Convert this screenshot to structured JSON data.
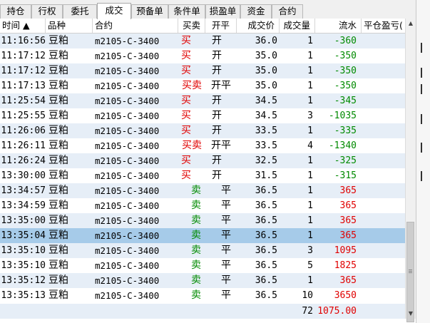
{
  "tabs": [
    {
      "label": "持仓",
      "active": false
    },
    {
      "label": "行权",
      "active": false
    },
    {
      "label": "委托",
      "active": false
    },
    {
      "label": "成交",
      "active": true
    },
    {
      "label": "预备单",
      "active": false
    },
    {
      "label": "条件单",
      "active": false
    },
    {
      "label": "损盈单",
      "active": false
    },
    {
      "label": "资金",
      "active": false
    },
    {
      "label": "合约",
      "active": false
    }
  ],
  "columns": {
    "time": "时间 ▲",
    "variety": "品种",
    "contract": "合约",
    "side": "买卖",
    "open_close": "开平",
    "price": "成交价",
    "qty": "成交量",
    "flow": "流水",
    "close_pnl": "平仓盈亏("
  },
  "rows": [
    {
      "time": "11:16:56",
      "variety": "豆粕",
      "contract": "m2105-C-3400",
      "side": "买",
      "open_close": "开",
      "price": "36.0",
      "qty": "1",
      "flow": "-360"
    },
    {
      "time": "11:17:12",
      "variety": "豆粕",
      "contract": "m2105-C-3400",
      "side": "买",
      "open_close": "开",
      "price": "35.0",
      "qty": "1",
      "flow": "-350"
    },
    {
      "time": "11:17:12",
      "variety": "豆粕",
      "contract": "m2105-C-3400",
      "side": "买",
      "open_close": "开",
      "price": "35.0",
      "qty": "1",
      "flow": "-350"
    },
    {
      "time": "11:17:13",
      "variety": "豆粕",
      "contract": "m2105-C-3400",
      "side": "买卖",
      "open_close": "开平",
      "price": "35.0",
      "qty": "1",
      "flow": "-350"
    },
    {
      "time": "11:25:54",
      "variety": "豆粕",
      "contract": "m2105-C-3400",
      "side": "买",
      "open_close": "开",
      "price": "34.5",
      "qty": "1",
      "flow": "-345"
    },
    {
      "time": "11:25:55",
      "variety": "豆粕",
      "contract": "m2105-C-3400",
      "side": "买",
      "open_close": "开",
      "price": "34.5",
      "qty": "3",
      "flow": "-1035"
    },
    {
      "time": "11:26:06",
      "variety": "豆粕",
      "contract": "m2105-C-3400",
      "side": "买",
      "open_close": "开",
      "price": "33.5",
      "qty": "1",
      "flow": "-335"
    },
    {
      "time": "11:26:11",
      "variety": "豆粕",
      "contract": "m2105-C-3400",
      "side": "买卖",
      "open_close": "开平",
      "price": "33.5",
      "qty": "4",
      "flow": "-1340"
    },
    {
      "time": "11:26:24",
      "variety": "豆粕",
      "contract": "m2105-C-3400",
      "side": "买",
      "open_close": "开",
      "price": "32.5",
      "qty": "1",
      "flow": "-325"
    },
    {
      "time": "13:30:00",
      "variety": "豆粕",
      "contract": "m2105-C-3400",
      "side": "买",
      "open_close": "开",
      "price": "31.5",
      "qty": "1",
      "flow": "-315"
    },
    {
      "time": "13:34:57",
      "variety": "豆粕",
      "contract": "m2105-C-3400",
      "side": "卖",
      "open_close": "平",
      "price": "36.5",
      "qty": "1",
      "flow": "365"
    },
    {
      "time": "13:34:59",
      "variety": "豆粕",
      "contract": "m2105-C-3400",
      "side": "卖",
      "open_close": "平",
      "price": "36.5",
      "qty": "1",
      "flow": "365"
    },
    {
      "time": "13:35:00",
      "variety": "豆粕",
      "contract": "m2105-C-3400",
      "side": "卖",
      "open_close": "平",
      "price": "36.5",
      "qty": "1",
      "flow": "365"
    },
    {
      "time": "13:35:04",
      "variety": "豆粕",
      "contract": "m2105-C-3400",
      "side": "卖",
      "open_close": "平",
      "price": "36.5",
      "qty": "1",
      "flow": "365",
      "selected": true
    },
    {
      "time": "13:35:10",
      "variety": "豆粕",
      "contract": "m2105-C-3400",
      "side": "卖",
      "open_close": "平",
      "price": "36.5",
      "qty": "3",
      "flow": "1095"
    },
    {
      "time": "13:35:10",
      "variety": "豆粕",
      "contract": "m2105-C-3400",
      "side": "卖",
      "open_close": "平",
      "price": "36.5",
      "qty": "5",
      "flow": "1825"
    },
    {
      "time": "13:35:12",
      "variety": "豆粕",
      "contract": "m2105-C-3400",
      "side": "卖",
      "open_close": "平",
      "price": "36.5",
      "qty": "1",
      "flow": "365"
    },
    {
      "time": "13:35:13",
      "variety": "豆粕",
      "contract": "m2105-C-3400",
      "side": "卖",
      "open_close": "平",
      "price": "36.5",
      "qty": "10",
      "flow": "3650"
    }
  ],
  "summary": {
    "qty": "72",
    "flow": "1075.00"
  },
  "colors": {
    "buy": "#e00000",
    "sell": "#008a00",
    "selected_row": "#a6cbe9",
    "alt_row": "#e6eef7"
  },
  "icons": {
    "scroll_up": "arrow-up-icon",
    "scroll_down": "arrow-down-icon"
  }
}
